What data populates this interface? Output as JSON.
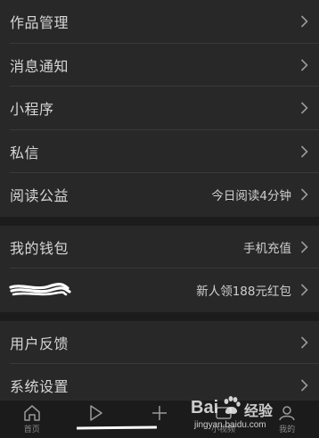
{
  "group1": [
    {
      "label": "作品管理",
      "value": ""
    },
    {
      "label": "消息通知",
      "value": ""
    },
    {
      "label": "小程序",
      "value": ""
    },
    {
      "label": "私信",
      "value": ""
    },
    {
      "label": "阅读公益",
      "value": "今日阅读4分钟"
    }
  ],
  "group2": [
    {
      "label": "我的钱包",
      "value": "手机充值"
    },
    {
      "label": "",
      "value": "新人领188元红包"
    }
  ],
  "group3": [
    {
      "label": "用户反馈",
      "value": ""
    },
    {
      "label": "系统设置",
      "value": ""
    }
  ],
  "tabbar": {
    "tabs": [
      {
        "label": "首页",
        "icon": "home-icon"
      },
      {
        "label": "",
        "icon": "play-icon"
      },
      {
        "label": "",
        "icon": "plus-icon"
      },
      {
        "label": "小视频",
        "icon": "small-video-icon"
      },
      {
        "label": "我的",
        "icon": "profile-icon"
      }
    ]
  },
  "watermark": {
    "brand": "Bai",
    "brand2": "经验",
    "url": "jingyan.baidu.com"
  },
  "colors": {
    "background": "#1f1f1f",
    "row": "#282828",
    "text": "#d6d6d6",
    "divider": "#3a3a3a"
  }
}
